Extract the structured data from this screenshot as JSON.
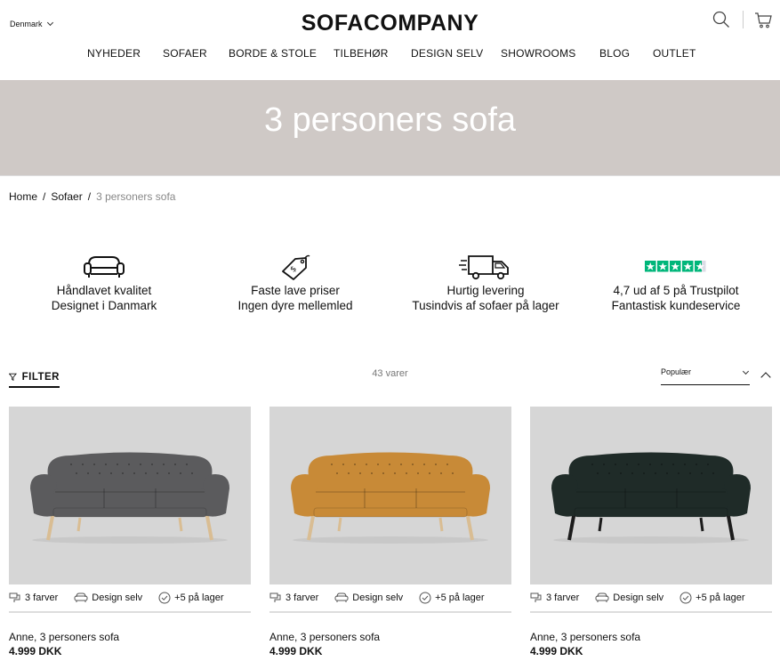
{
  "header": {
    "country": "Denmark",
    "logo": "SOFACOMPANY",
    "nav": [
      "NYHEDER",
      "SOFAER",
      "BORDE & STOLE",
      "TILBEHØR",
      "DESIGN SELV",
      "SHOWROOMS",
      "BLOG",
      "OUTLET"
    ]
  },
  "hero": {
    "title": "3 personers sofa"
  },
  "breadcrumb": {
    "home": "Home",
    "section": "Sofaer",
    "current": "3 personers sofa",
    "separator": "/"
  },
  "usps": [
    {
      "icon": "sofa-icon",
      "line1": "Håndlavet kvalitet",
      "line2": "Designet i Danmark"
    },
    {
      "icon": "price-tag-icon",
      "line1": "Faste lave priser",
      "line2": "Ingen dyre mellemled"
    },
    {
      "icon": "delivery-truck-icon",
      "line1": "Hurtig levering",
      "line2": "Tusindvis af sofaer på lager"
    },
    {
      "icon": "trustpilot-stars-icon",
      "line1": "4,7 ud af 5 på Trustpilot",
      "line2": "Fantastisk kundeservice"
    }
  ],
  "toolbar": {
    "filter_label": "FILTER",
    "count": "43 varer",
    "sort_value": "Populær"
  },
  "products": [
    {
      "name": "Anne, 3 personers sofa",
      "price": "4.999 DKK",
      "colors": "3 farver",
      "design": "Design selv",
      "stock": "+5 på lager",
      "fabric_color": "#5b5b5d",
      "leg_color": "#d9bd93"
    },
    {
      "name": "Anne, 3 personers sofa",
      "price": "4.999 DKK",
      "colors": "3 farver",
      "design": "Design selv",
      "stock": "+5 på lager",
      "fabric_color": "#c88a37",
      "leg_color": "#d9bd93"
    },
    {
      "name": "Anne, 3 personers sofa",
      "price": "4.999 DKK",
      "colors": "3 farver",
      "design": "Design selv",
      "stock": "+5 på lager",
      "fabric_color": "#1f2b28",
      "leg_color": "#1c1c1c"
    }
  ],
  "colors": {
    "hero_bg": "#cfc9c6",
    "trustpilot_green": "#00b67a",
    "image_bg": "#d6d6d6"
  }
}
